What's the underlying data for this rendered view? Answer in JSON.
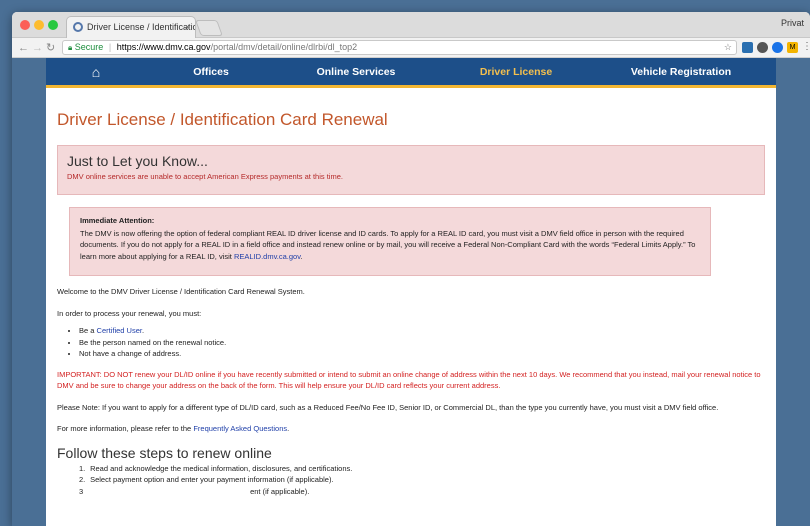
{
  "browser": {
    "tab_title": "Driver License / Identificatio",
    "tab_close": "×",
    "profile": "Privat",
    "secure_label": "Secure",
    "url_host": "https://www.dmv.ca.gov",
    "url_path": "/portal/dmv/detail/online/dlrbi/dl_top2"
  },
  "nav": {
    "items": [
      "Offices",
      "Online Services",
      "Driver License",
      "Vehicle Registration"
    ],
    "active": "Driver License",
    "colors": {
      "bar": "#1d4f89",
      "accent": "#f2b632",
      "active_text": "#f4c04e"
    }
  },
  "page": {
    "title": "Driver License / Identification Card Renewal",
    "notice1": {
      "heading": "Just to Let you Know...",
      "text": "DMV online services are unable to accept American Express payments at this time."
    },
    "notice2": {
      "heading": "Immediate Attention:",
      "text": "The DMV is now offering the option of federal compliant REAL ID driver license and ID cards. To apply for a REAL ID card, you must visit a DMV field office in person with the required documents. If you do not apply for a REAL ID in a field office and instead renew online or by mail, you will receive a Federal Non-Compliant Card with the words “Federal Limits Apply.” To learn more about applying for a REAL ID, visit",
      "link": "REALID.dmv.ca.gov",
      "after": "."
    },
    "welcome": "Welcome to the DMV Driver License / Identification Card Renewal System.",
    "process_intro": "In order to process your renewal, you must:",
    "bullets": {
      "b1_prefix": "Be a",
      "b1_link": "Certified User",
      "b1_suffix": ".",
      "b2": "Be the person named on the renewal notice.",
      "b3": "Not have a change of address."
    },
    "important": "IMPORTANT: DO NOT renew your DL/ID online if you have recently submitted or intend to submit an online change of address within the next 10 days. We recommend that you instead, mail your renewal notice to DMV and be sure to change your address on the back of the form. This will help ensure your DL/ID card reflects your current address.",
    "please_note": "Please Note: If you want to apply for a different type of DL/ID card, such as a Reduced Fee/No Fee ID, Senior ID, or Commercial DL, than the type you currently have, you must visit a DMV field office.",
    "more_info_prefix": "For more information, please refer to the",
    "more_info_link": "Frequently Asked Questions",
    "more_info_suffix": ".",
    "steps_heading": "Follow these steps to renew online",
    "steps": [
      {
        "num": "1.",
        "text": "Read and acknowledge the medical information, disclosures, and certifications."
      },
      {
        "num": "2.",
        "text": "Select payment option and enter your payment information (if applicable)."
      },
      {
        "num": "3",
        "text": "ent (if applicable)."
      }
    ]
  }
}
